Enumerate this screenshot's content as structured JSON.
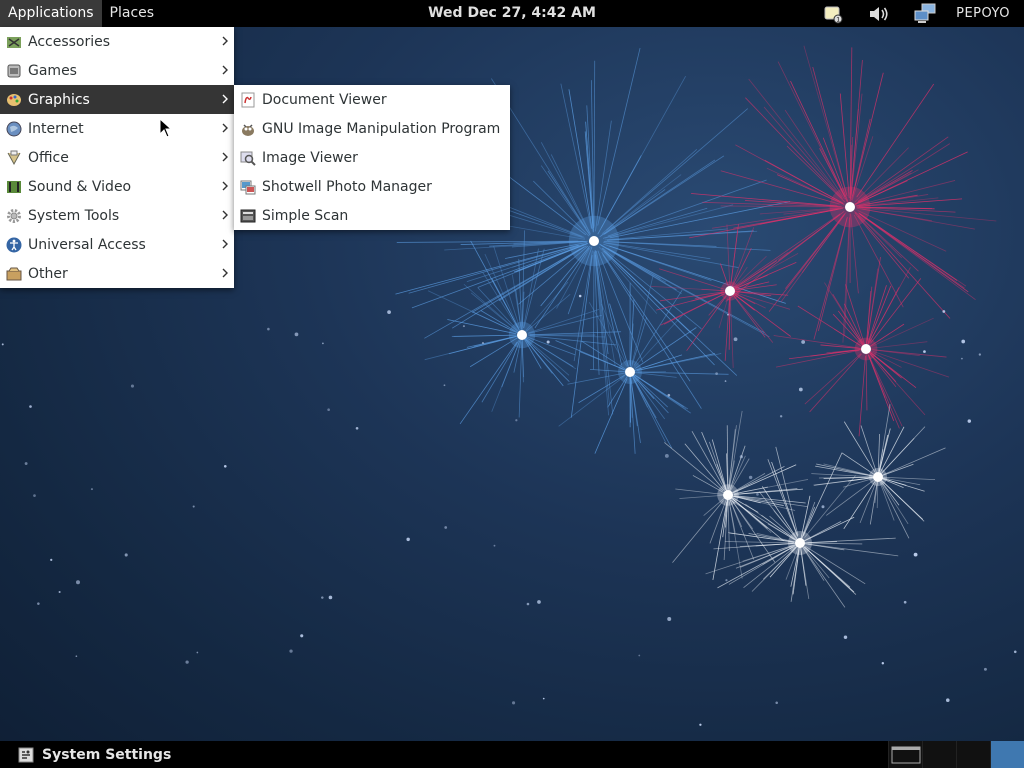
{
  "top_panel": {
    "applications_label": "Applications",
    "places_label": "Places",
    "clock": "Wed Dec 27,  4:42 AM",
    "user": "PEPOYO"
  },
  "apps_menu": {
    "items": [
      {
        "label": "Accessories",
        "icon": "accessories-icon"
      },
      {
        "label": "Games",
        "icon": "games-icon"
      },
      {
        "label": "Graphics",
        "icon": "graphics-icon"
      },
      {
        "label": "Internet",
        "icon": "internet-icon"
      },
      {
        "label": "Office",
        "icon": "office-icon"
      },
      {
        "label": "Sound & Video",
        "icon": "sound-video-icon"
      },
      {
        "label": "System Tools",
        "icon": "system-tools-icon"
      },
      {
        "label": "Universal Access",
        "icon": "universal-access-icon"
      },
      {
        "label": "Other",
        "icon": "other-icon"
      }
    ],
    "selected": "Graphics"
  },
  "graphics_submenu": {
    "items": [
      {
        "label": "Document Viewer",
        "icon": "document-viewer-icon"
      },
      {
        "label": "GNU Image Manipulation Program",
        "icon": "gimp-icon"
      },
      {
        "label": "Image Viewer",
        "icon": "image-viewer-icon"
      },
      {
        "label": "Shotwell Photo Manager",
        "icon": "shotwell-icon"
      },
      {
        "label": "Simple Scan",
        "icon": "simple-scan-icon"
      }
    ]
  },
  "bottom_panel": {
    "taskbar_label": "System Settings"
  },
  "colors": {
    "panel_bg": "#000000",
    "menu_selected_bg": "#353535",
    "workspace_active": "#3f78b0",
    "firework_blue": "#5a9be0",
    "firework_pink": "#e0306a",
    "firework_white": "#e8eef5"
  }
}
